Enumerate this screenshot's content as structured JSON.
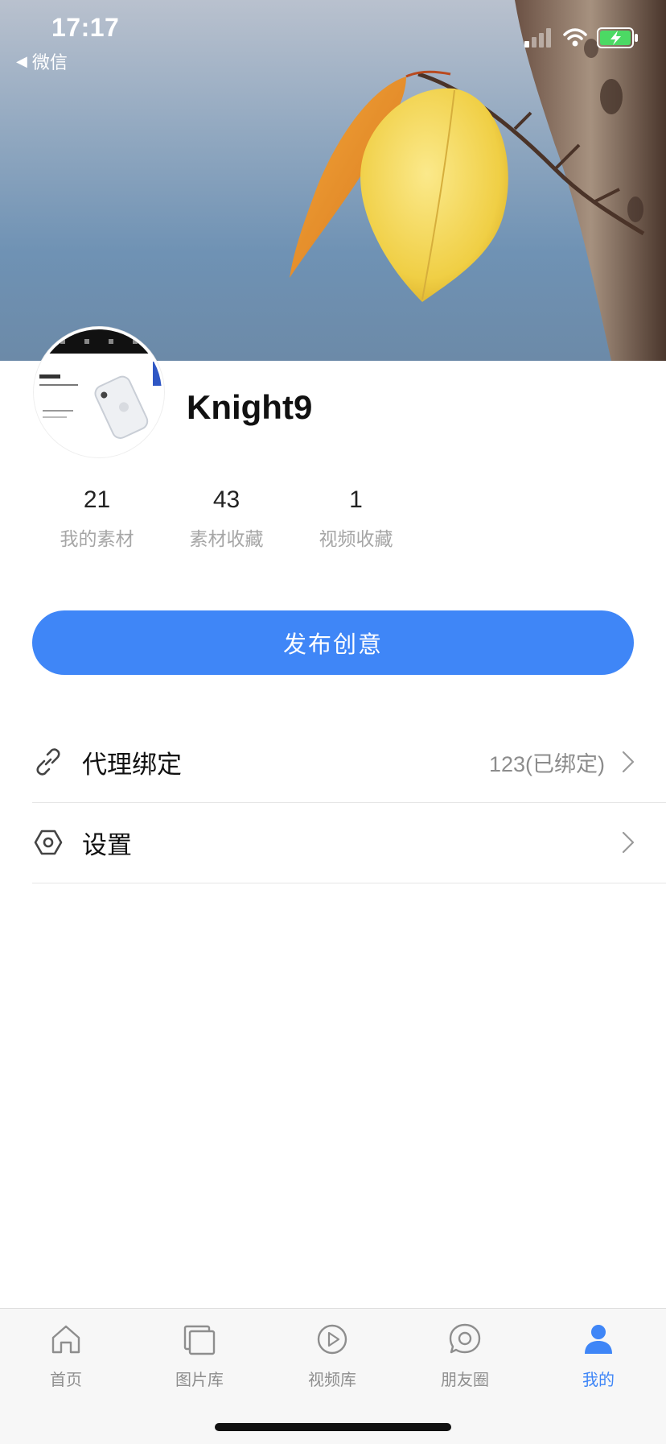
{
  "status_bar": {
    "time": "17:17",
    "back_app": "微信"
  },
  "profile": {
    "username": "Knight9"
  },
  "stats": [
    {
      "value": "21",
      "label": "我的素材"
    },
    {
      "value": "43",
      "label": "素材收藏"
    },
    {
      "value": "1",
      "label": "视频收藏"
    }
  ],
  "publish_button": "发布创意",
  "menu": [
    {
      "label": "代理绑定",
      "value": "123(已绑定)",
      "icon": "link-icon"
    },
    {
      "label": "设置",
      "value": "",
      "icon": "hexagon-settings-icon"
    }
  ],
  "tabs": [
    {
      "label": "首页",
      "icon": "home-icon",
      "active": false
    },
    {
      "label": "图片库",
      "icon": "gallery-icon",
      "active": false
    },
    {
      "label": "视频库",
      "icon": "play-icon",
      "active": false
    },
    {
      "label": "朋友圈",
      "icon": "moments-icon",
      "active": false
    },
    {
      "label": "我的",
      "icon": "user-icon",
      "active": true
    }
  ],
  "colors": {
    "accent": "#3f86f7",
    "tab_inactive": "#8e8e8e",
    "battery": "#4cd964"
  }
}
